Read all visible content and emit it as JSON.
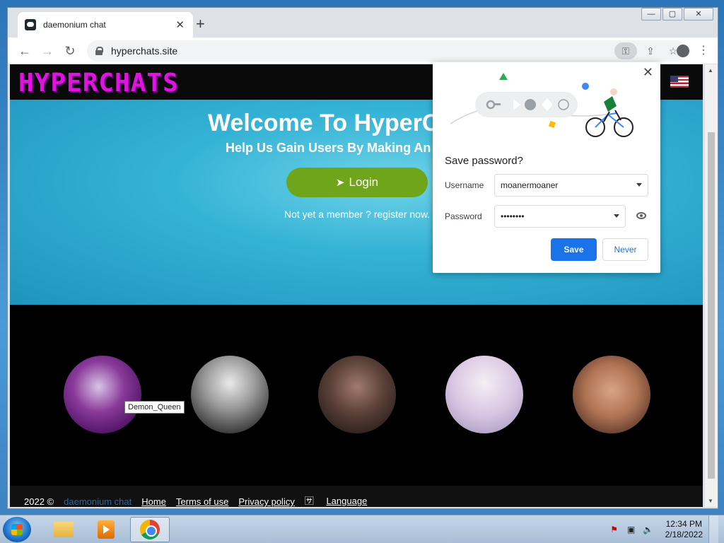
{
  "browser": {
    "tab_title": "daemonium chat",
    "tab_close": "✕",
    "new_tab": "+",
    "url": "hyperchats.site",
    "win_min": "—",
    "win_max": "▢",
    "win_close": "✕"
  },
  "site": {
    "logo": "HYPERCHATS",
    "hero_title": "Welcome To HyperC",
    "hero_subtitle": "Help Us Gain Users By Making An",
    "login_label": "Login",
    "register_text": "Not yet a member ? register now.",
    "tooltip": "Demon_Queen",
    "footer": {
      "copyright": "2022 ©",
      "brand": "daemonium chat",
      "links": [
        "Home",
        "Terms of use",
        "Privacy policy",
        "Language"
      ]
    }
  },
  "password_prompt": {
    "title": "Save password?",
    "username_label": "Username",
    "username_value": "moanermoaner",
    "password_label": "Password",
    "password_value": "••••••••",
    "save_label": "Save",
    "never_label": "Never",
    "close": "✕"
  },
  "taskbar": {
    "time": "12:34 PM",
    "date": "2/18/2022"
  },
  "colors": {
    "accent_blue": "#1a73e8",
    "login_green": "#6fa51a",
    "logo_magenta": "#e014e0",
    "hero_cyan": "#35b3d6"
  }
}
